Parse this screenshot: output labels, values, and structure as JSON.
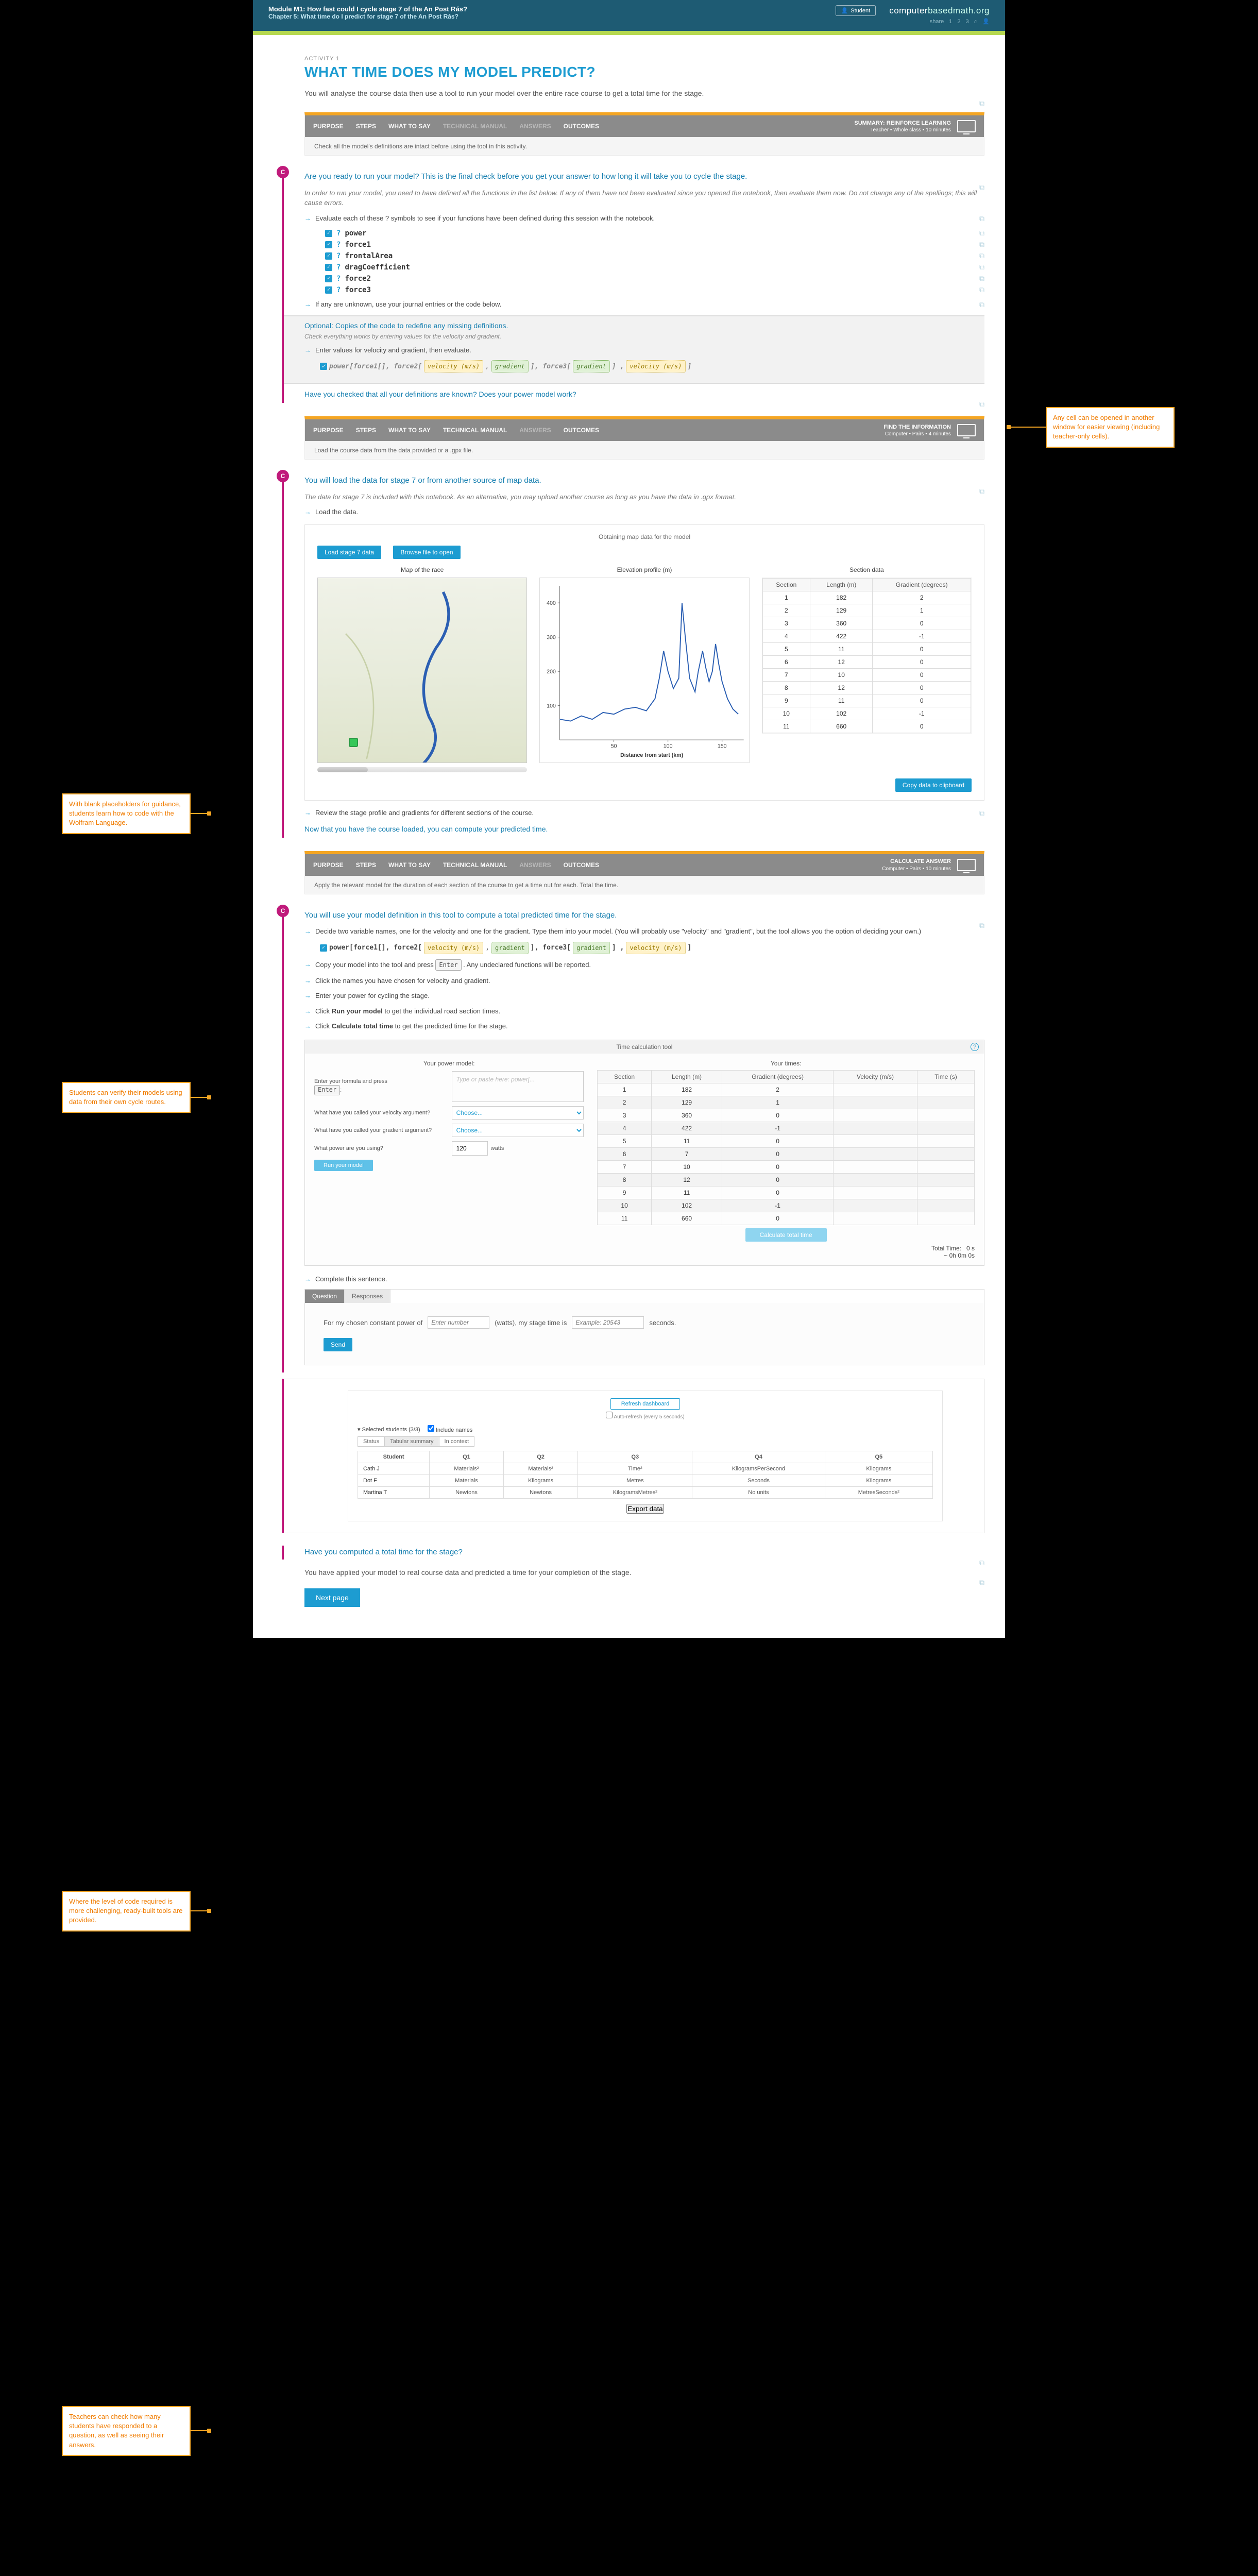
{
  "header": {
    "module": "Module M1: How fast could I cycle stage 7 of the An Post Rás?",
    "chapter": "Chapter 5: What time do I predict for stage 7 of the An Post Rás?",
    "student_badge": "Student",
    "brand_bold": "computer",
    "brand_light": "basedmath.org",
    "share": "share",
    "nav": [
      "1",
      "2",
      "3"
    ]
  },
  "activity_label": "ACTIVITY 1",
  "title": "WHAT TIME DOES MY MODEL PREDICT?",
  "intro": "You will analyse the course data then use a tool to run your model over the entire race course to get a total time for the stage.",
  "band1": {
    "tabs": [
      "PURPOSE",
      "STEPS",
      "WHAT TO SAY",
      "TECHNICAL MANUAL",
      "ANSWERS",
      "OUTCOMES"
    ],
    "dim": [
      "TECHNICAL MANUAL",
      "ANSWERS"
    ],
    "meta_title": "SUMMARY: REINFORCE LEARNING",
    "meta_sub": "Teacher • Whole class • 10 minutes",
    "desc": "Check all the model's definitions are intact before using the tool in this activity."
  },
  "thread1": {
    "lead": "Are you ready to run your model? This is the final check before you get your answer to how long it will take you to cycle the stage.",
    "note": "In order to run your model, you need to have defined all the functions in the list below. If any of them have not been evaluated since you opened the notebook, then evaluate them now. Do not change any of the spellings; this will cause errors.",
    "arrow1": "Evaluate each of these ? symbols to see if your functions have been defined during this session with the notebook.",
    "codes": [
      "? power",
      "? force1",
      "? frontalArea",
      "? dragCoefficient",
      "? force2",
      "? force3"
    ],
    "arrow2": "If any are unknown, use your journal entries or the code below.",
    "optional_hdr": "Optional: Copies of the code to redefine any missing definitions.",
    "optional_sub": "Check everything works by entering values for the velocity and gradient.",
    "arrow3": "Enter values for velocity and gradient, then evaluate.",
    "code_line_prefix": "power[force1[], force2[",
    "code_line_mid1": "], force3[",
    "code_line_mid2": "] , ",
    "code_line_end": " ]",
    "vel_ph": "velocity (m/s)",
    "grad_ph": "gradient",
    "check_q": "Have you checked that all your definitions are known? Does your power model work?"
  },
  "band2": {
    "tabs": [
      "PURPOSE",
      "STEPS",
      "WHAT TO SAY",
      "TECHNICAL MANUAL",
      "ANSWERS",
      "OUTCOMES"
    ],
    "dim": [
      "ANSWERS"
    ],
    "meta_title": "FIND THE INFORMATION",
    "meta_sub": "Computer • Pairs • 4 minutes",
    "desc": "Load the course data from the data provided or a .gpx file."
  },
  "thread2": {
    "lead": "You will load the data for stage 7 or from another source of map data.",
    "note": "The data for stage 7 is included with this notebook. As an alternative, you may upload another course as long as you have the data in .gpx format.",
    "arrow1": "Load the data.",
    "panel_title": "Obtaining map data for the model",
    "btn_load": "Load stage 7 data",
    "btn_browse": "Browse file to open",
    "col_map": "Map of the race",
    "col_elev": "Elevation profile (m)",
    "col_sect": "Section data",
    "axis_y": [
      "100",
      "200",
      "300",
      "400"
    ],
    "axis_x": [
      "50",
      "100",
      "150"
    ],
    "axis_label": "Distance from start (km)",
    "table_head": [
      "Section",
      "Length (m)",
      "Gradient (degrees)"
    ],
    "copy_btn": "Copy data to clipboard",
    "arrow2": "Review the stage profile and gradients for different sections of the course.",
    "lead2": "Now that you have the course loaded, you can compute your predicted time."
  },
  "chart_data": {
    "type": "line",
    "title": "Elevation profile (m)",
    "xlabel": "Distance from start (km)",
    "ylabel": "",
    "xlim": [
      0,
      170
    ],
    "ylim": [
      0,
      450
    ],
    "x_ticks": [
      50,
      100,
      150
    ],
    "y_ticks": [
      100,
      200,
      300,
      400
    ],
    "x": [
      0,
      10,
      20,
      30,
      40,
      50,
      60,
      70,
      80,
      88,
      92,
      96,
      100,
      105,
      110,
      113,
      116,
      120,
      125,
      128,
      132,
      135,
      138,
      141,
      144,
      147,
      150,
      155,
      160,
      165
    ],
    "values": [
      60,
      55,
      70,
      60,
      80,
      75,
      90,
      95,
      85,
      120,
      180,
      260,
      200,
      150,
      180,
      400,
      300,
      180,
      140,
      200,
      260,
      210,
      170,
      200,
      280,
      220,
      170,
      120,
      90,
      75
    ]
  },
  "section_data": [
    {
      "n": 1,
      "len": 182,
      "grad": 2
    },
    {
      "n": 2,
      "len": 129,
      "grad": 1
    },
    {
      "n": 3,
      "len": 360,
      "grad": 0
    },
    {
      "n": 4,
      "len": 422,
      "grad": -1
    },
    {
      "n": 5,
      "len": 11,
      "grad": 0
    },
    {
      "n": 6,
      "len": 12,
      "grad": 0
    },
    {
      "n": 7,
      "len": 10,
      "grad": 0
    },
    {
      "n": 8,
      "len": 12,
      "grad": 0
    },
    {
      "n": 9,
      "len": 11,
      "grad": 0
    },
    {
      "n": 10,
      "len": 102,
      "grad": -1
    },
    {
      "n": 11,
      "len": 660,
      "grad": 0
    }
  ],
  "band3": {
    "tabs": [
      "PURPOSE",
      "STEPS",
      "WHAT TO SAY",
      "TECHNICAL MANUAL",
      "ANSWERS",
      "OUTCOMES"
    ],
    "dim": [
      "ANSWERS"
    ],
    "meta_title": "CALCULATE ANSWER",
    "meta_sub": "Computer • Pairs • 10 minutes",
    "desc": "Apply the relevant model for the duration of each section of the course to get a time out for each. Total the time."
  },
  "thread3": {
    "lead": "You will use your model definition in this tool to compute a total predicted time for the stage.",
    "arrow1": "Decide two variable names, one for the velocity and one for the gradient. Type them into your model. (You will probably use \"velocity\" and \"gradient\", but the tool allows you the option of deciding your own.)",
    "arrow2_pre": "Copy your model into the tool and press ",
    "arrow2_post": ". Any undeclared functions will be reported.",
    "enter_key": "Enter",
    "arrow3": "Click the names you have chosen for velocity and gradient.",
    "arrow4": "Enter your power for cycling the stage.",
    "arrow5_pre": "Click ",
    "arrow5_bold": "Run your model",
    "arrow5_post": " to get the individual road section times.",
    "arrow6_pre": "Click ",
    "arrow6_bold": "Calculate total time",
    "arrow6_post": " to get the predicted time for the stage.",
    "tool_title": "Time calculation tool",
    "col_model": "Your power model:",
    "col_times": "Your times:",
    "lbl_formula": "Enter your formula and press",
    "ph_formula": "Type or paste here: power[...",
    "lbl_vel": "What have you called your velocity argument?",
    "lbl_grad": "What have you called your gradient argument?",
    "choose": "Choose...",
    "lbl_power": "What power are you using?",
    "power_val": "120",
    "power_unit": "watts",
    "btn_run": "Run your model",
    "times_head": [
      "Section",
      "Length (m)",
      "Gradient (degrees)",
      "Velocity (m/s)",
      "Time (s)"
    ],
    "btn_calc": "Calculate total time",
    "total_label": "Total Time:",
    "total_val": "0 s",
    "total_fmt": "~ 0h 0m 0s",
    "arrow7": "Complete this sentence.",
    "qa_tabs": [
      "Question",
      "Responses"
    ],
    "sentence_pre": "For my chosen constant power of",
    "sentence_mid": "(watts), my stage time is",
    "sentence_end": "seconds.",
    "ph_number": "Enter number",
    "ex": "Example: 20543",
    "btn_send": "Send"
  },
  "times_data": [
    {
      "n": 1,
      "len": 182,
      "grad": 2
    },
    {
      "n": 2,
      "len": 129,
      "grad": 1
    },
    {
      "n": 3,
      "len": 360,
      "grad": 0
    },
    {
      "n": 4,
      "len": 422,
      "grad": -1
    },
    {
      "n": 5,
      "len": 11,
      "grad": 0
    },
    {
      "n": 6,
      "len": 7,
      "grad": 0
    },
    {
      "n": 7,
      "len": 10,
      "grad": 0
    },
    {
      "n": 8,
      "len": 12,
      "grad": 0
    },
    {
      "n": 9,
      "len": 11,
      "grad": 0
    },
    {
      "n": 10,
      "len": 102,
      "grad": -1
    },
    {
      "n": 11,
      "len": 660,
      "grad": 0
    }
  ],
  "dashboard": {
    "refresh": "Refresh dashboard",
    "auto": "Auto-refresh (every 5 seconds)",
    "selected": "Selected students (3/3)",
    "include": "Include names",
    "seg": [
      "Status",
      "Tabular summary",
      "In context"
    ],
    "head": [
      "Student",
      "Q1",
      "Q2",
      "Q3",
      "Q4",
      "Q5"
    ],
    "rows": [
      [
        "Cath J",
        "Materials²",
        "Materials²",
        "Time²",
        "KilogramsPerSecond",
        "Kilograms"
      ],
      [
        "Dot F",
        "Materials",
        "Kilograms",
        "Metres",
        "Seconds",
        "Kilograms"
      ],
      [
        "Martina T",
        "Newtons",
        "Newtons",
        "KilogramsMetres²",
        "No units",
        "MetresSeconds²"
      ]
    ],
    "export": "Export data"
  },
  "closing_q": "Have you computed a total time for the stage?",
  "closing_text": "You have applied your model to real course data and predicted a time for your completion of the stage.",
  "next": "Next page",
  "callouts": {
    "c1": "With blank placeholders for guidance, students learn how to code with the Wolfram Language.",
    "c2": "Students can verify their models using data from their own cycle routes.",
    "c3": "Where the level of code required is more challenging, ready-built tools are provided.",
    "c4": "Teachers can check how many students have responded to a question, as well as seeing their answers.",
    "c5": "Any cell can be opened in another window for easier viewing (including teacher-only cells)."
  }
}
